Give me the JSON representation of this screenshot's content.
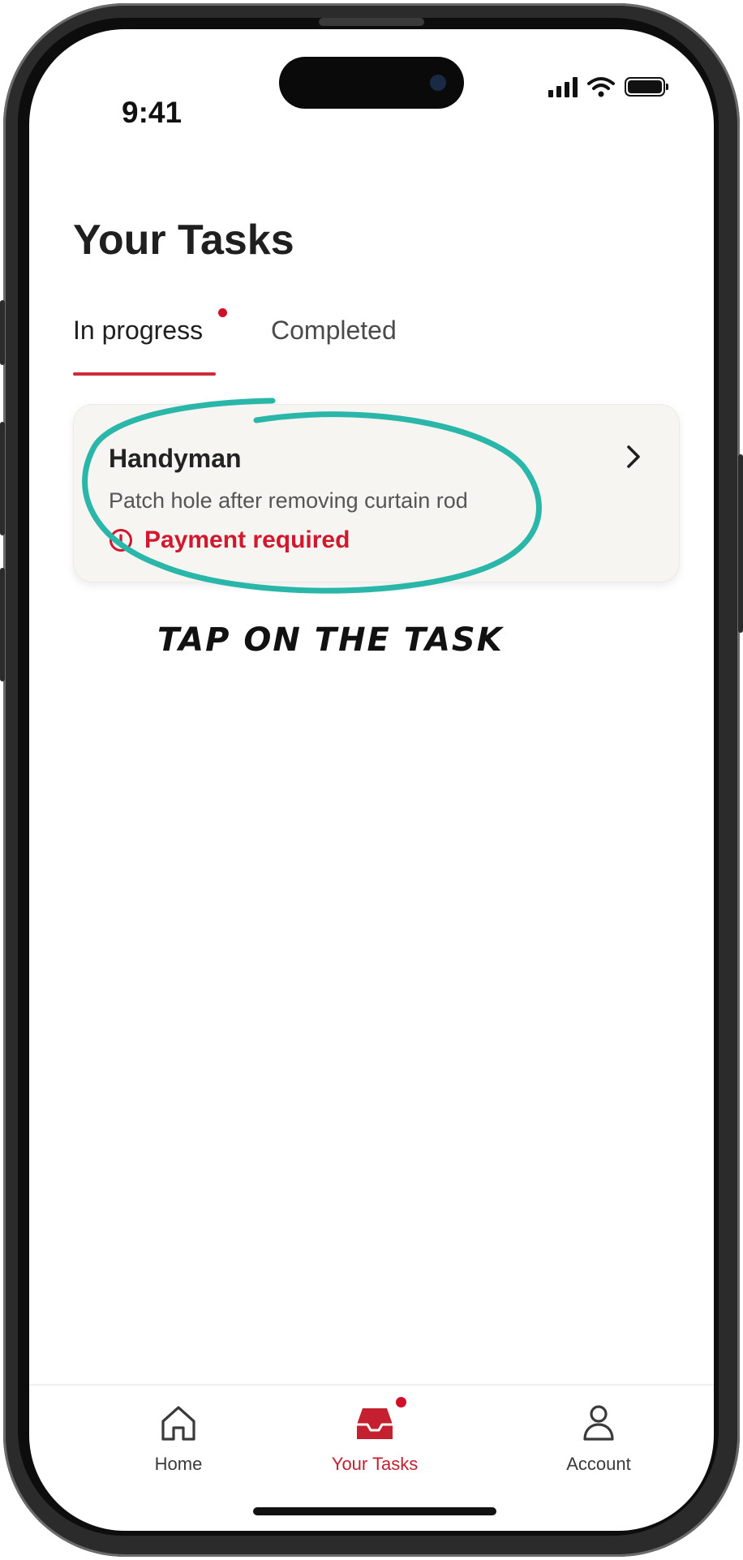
{
  "status_bar": {
    "time": "9:41"
  },
  "header": {
    "title": "Your Tasks"
  },
  "tabs": [
    {
      "label": "In progress",
      "active": true,
      "has_notification": true
    },
    {
      "label": "Completed",
      "active": false
    }
  ],
  "task": {
    "title": "Handyman",
    "description": "Patch hole after removing curtain rod",
    "status": "Payment required",
    "status_color": "#d0182f"
  },
  "annotation": {
    "text": "TAP ON THE TASK",
    "color": "#2ab7a9"
  },
  "bottom_nav": {
    "items": [
      {
        "label": "Home",
        "icon": "home-icon",
        "active": false
      },
      {
        "label": "Your Tasks",
        "icon": "inbox-icon",
        "active": true,
        "has_notification": true
      },
      {
        "label": "Account",
        "icon": "account-icon",
        "active": false
      }
    ]
  },
  "colors": {
    "accent": "#cf2a3a",
    "card_bg": "#f6f5f1"
  }
}
